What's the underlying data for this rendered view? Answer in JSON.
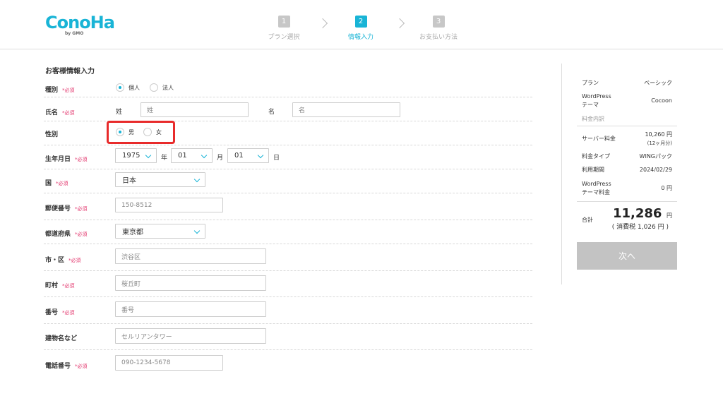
{
  "header": {
    "logo": "ConoHa",
    "logo_sub": "by GMO",
    "steps": [
      {
        "num": "1",
        "label": "プラン選択"
      },
      {
        "num": "2",
        "label": "情報入力"
      },
      {
        "num": "3",
        "label": "お支払い方法"
      }
    ]
  },
  "form": {
    "title": "お客様情報入力",
    "required_mark": "*必須",
    "type": {
      "label": "種別",
      "options": [
        "個人",
        "法人"
      ],
      "selected": "個人"
    },
    "name": {
      "label": "氏名",
      "sei_label": "姓",
      "sei_placeholder": "姓",
      "mei_label": "名",
      "mei_placeholder": "名"
    },
    "gender": {
      "label": "性別",
      "options": [
        "男",
        "女"
      ],
      "selected": "男"
    },
    "birthday": {
      "label": "生年月日",
      "year": "1975",
      "year_unit": "年",
      "month": "01",
      "month_unit": "月",
      "day": "01",
      "day_unit": "日"
    },
    "country": {
      "label": "国",
      "value": "日本"
    },
    "postal": {
      "label": "郵便番号",
      "placeholder": "150-8512"
    },
    "prefecture": {
      "label": "都道府県",
      "value": "東京都"
    },
    "city": {
      "label": "市・区",
      "placeholder": "渋谷区"
    },
    "town": {
      "label": "町村",
      "placeholder": "桜丘町"
    },
    "number": {
      "label": "番号",
      "placeholder": "番号"
    },
    "building": {
      "label": "建物名など",
      "placeholder": "セルリアンタワー"
    },
    "phone": {
      "label": "電話番号",
      "placeholder": "090-1234-5678"
    }
  },
  "summary": {
    "plan_label": "プラン",
    "plan_value": "ベーシック",
    "wp_theme_label_1": "WordPress",
    "wp_theme_label_2": "テーマ",
    "wp_theme_value": "Cocoon",
    "breakdown_label": "料金内訳",
    "server_fee_label": "サーバー料金",
    "server_fee_value": "10,260 円",
    "server_fee_note": "(12ヶ月分)",
    "fee_type_label": "料金タイプ",
    "fee_type_value": "WINGパック",
    "period_label": "利用期間",
    "period_value": "2024/02/29",
    "wp_fee_label_1": "WordPress",
    "wp_fee_label_2": "テーマ料金",
    "wp_fee_value": "0 円",
    "total_label": "合計",
    "total_value": "11,286",
    "total_unit": "円",
    "tax_note": "( 消費税 1,026 円 )",
    "next_button": "次へ"
  },
  "colors": {
    "accent": "#19b4d6",
    "required": "#e2336b",
    "highlight": "#e82b2b",
    "button_disabled": "#c3c3c3"
  }
}
